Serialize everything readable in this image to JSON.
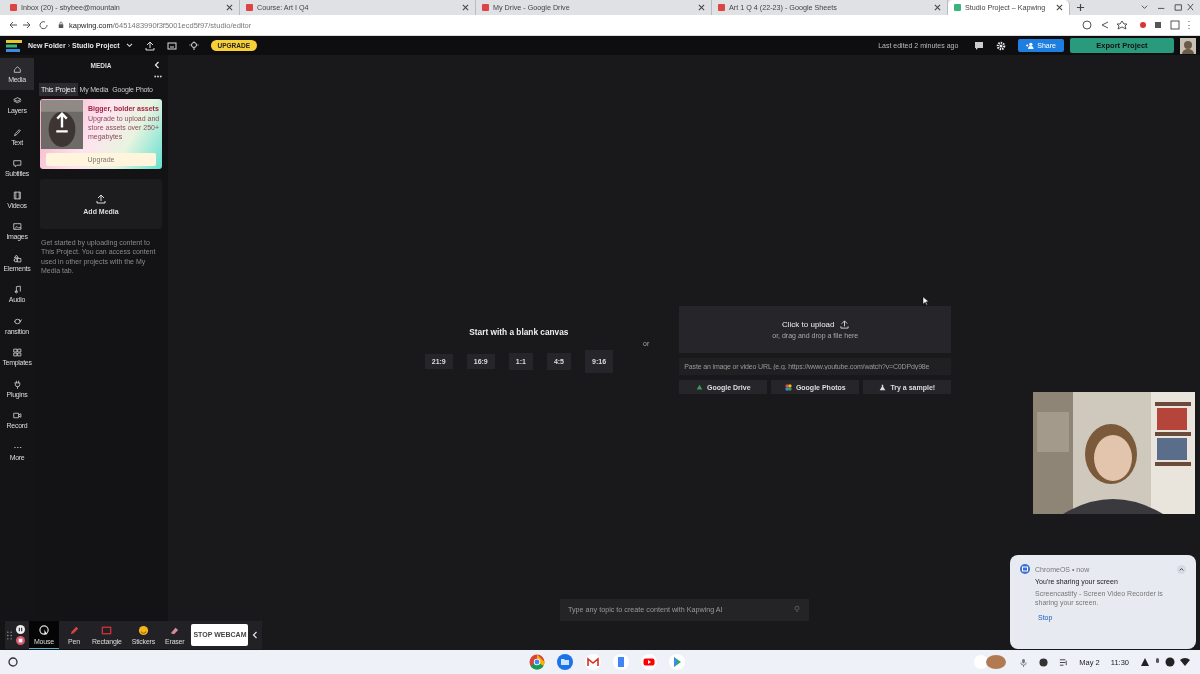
{
  "browser": {
    "tabs": [
      {
        "title": "Inbox (20) - sbybee@mountain",
        "selected": false
      },
      {
        "title": "Course: Art I Q4",
        "selected": false
      },
      {
        "title": "My Drive - Google Drive",
        "selected": false
      },
      {
        "title": "Art 1 Q 4 (22-23) - Google Sheets",
        "selected": false
      },
      {
        "title": "Studio Project – Kapwing",
        "selected": true
      }
    ],
    "url": {
      "domain": "kapwing.com",
      "path": "/6451483990f3f5001ecd5f97/studio/editor"
    }
  },
  "topbar": {
    "folder": "New Folder",
    "separator": "›",
    "project": "Studio Project",
    "upgrade": "UPGRADE",
    "last_edited": "Last edited 2 minutes ago",
    "share": "Share",
    "export": "Export Project"
  },
  "nav": [
    {
      "label": "Media",
      "selected": true
    },
    {
      "label": "Layers",
      "selected": false
    },
    {
      "label": "Text",
      "selected": false
    },
    {
      "label": "Subtitles",
      "selected": false
    },
    {
      "label": "Videos",
      "selected": false
    },
    {
      "label": "Images",
      "selected": false
    },
    {
      "label": "Elements",
      "selected": false
    },
    {
      "label": "Audio",
      "selected": false
    },
    {
      "label": "ransition",
      "selected": false
    },
    {
      "label": "Templates",
      "selected": false
    },
    {
      "label": "Plugins",
      "selected": false
    },
    {
      "label": "Record",
      "selected": false
    },
    {
      "label": "More",
      "selected": false
    }
  ],
  "media": {
    "title": "MEDIA",
    "tabs": [
      {
        "label": "This Project",
        "selected": true
      },
      {
        "label": "My Media",
        "selected": false
      },
      {
        "label": "Google Photo",
        "selected": false
      }
    ],
    "promo": {
      "title": "Bigger, bolder assets",
      "text": "Upgrade to upload and store assets over 250+ megabytes",
      "button": "Upgrade"
    },
    "add_media": "Add Media",
    "help": "Get started by uploading content to This Project. You can access content used in other projects with the My Media tab."
  },
  "canvas": {
    "blank_title": "Start with a blank canvas",
    "ratios": [
      "21:9",
      "16:9",
      "1:1",
      "4:5",
      "9:16"
    ],
    "or": "or",
    "upload_title": "Click to upload",
    "upload_subtitle": "or, drag and drop a file here",
    "url_placeholder": "Paste an image or video URL (e.g. https://www.youtube.com/watch?v=C0DPdy98e",
    "sources": [
      "Google Drive",
      "Google Photos",
      "Try a sample!"
    ]
  },
  "ai_prompt": {
    "placeholder": "Type any topic to create content with Kapwing AI"
  },
  "recorder": {
    "tools": [
      {
        "label": "Mouse",
        "selected": true
      },
      {
        "label": "Pen",
        "selected": false
      },
      {
        "label": "Rectangle",
        "selected": false
      },
      {
        "label": "Stickers",
        "selected": false
      },
      {
        "label": "Eraser",
        "selected": false
      }
    ],
    "stop_webcam": "STOP WEBCAM"
  },
  "notification": {
    "source": "ChromeOS • now",
    "title": "You're sharing your screen",
    "text": "Screencastify - Screen Video Recorder is sharing your screen.",
    "action": "Stop"
  },
  "shelf": {
    "date": "May 2",
    "time": "11:30"
  }
}
